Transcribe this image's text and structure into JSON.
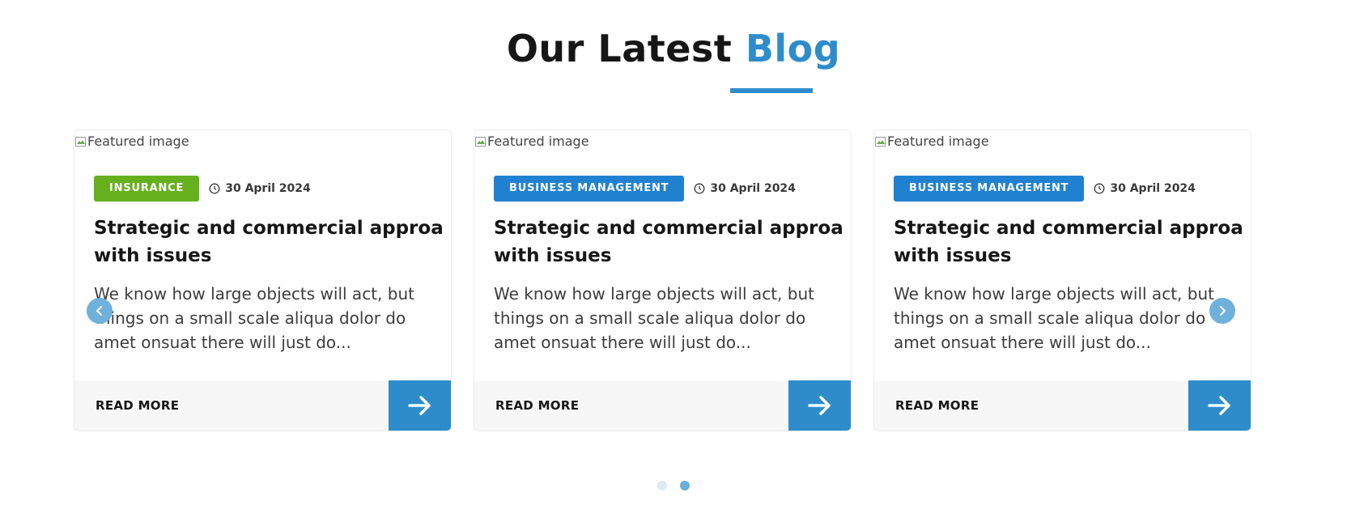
{
  "heading": {
    "prefix": "Our Latest",
    "accent": "Blog"
  },
  "colors": {
    "accent": "#2f8ccb",
    "insurance_badge": "#66b01e",
    "business_badge": "#2181d1",
    "nav_button": "#6fb0dd"
  },
  "cards": [
    {
      "image_alt": "Featured image",
      "category": "INSURANCE",
      "category_color": "#66b01e",
      "date": "30 April 2024",
      "title_line1": "Strategic and commercial approac",
      "title_line2": "with issues",
      "excerpt": "We know how large objects will act, but things on a small scale aliqua dolor do amet onsuat there will just do...",
      "read_more": "READ MORE",
      "arrow_icon": "arrow-right-icon"
    },
    {
      "image_alt": "Featured image",
      "category": "BUSINESS MANAGEMENT",
      "category_color": "#2181d1",
      "date": "30 April 2024",
      "title_line1": "Strategic and commercial approac",
      "title_line2": "with issues",
      "excerpt": "We know how large objects will act, but things on a small scale aliqua dolor do amet onsuat there will just do...",
      "read_more": "READ MORE",
      "arrow_icon": "arrow-right-icon"
    },
    {
      "image_alt": "Featured image",
      "category": "BUSINESS MANAGEMENT",
      "category_color": "#2181d1",
      "date": "30 April 2024",
      "title_line1": "Strategic and commercial approac",
      "title_line2": "with issues",
      "excerpt": "We know how large objects will act, but things on a small scale aliqua dolor do amet onsuat there will just do...",
      "read_more": "READ MORE",
      "arrow_icon": "arrow-right-icon"
    }
  ],
  "carousel": {
    "prev_icon": "chevron-left-icon",
    "next_icon": "chevron-right-icon",
    "dots": [
      false,
      true
    ]
  }
}
